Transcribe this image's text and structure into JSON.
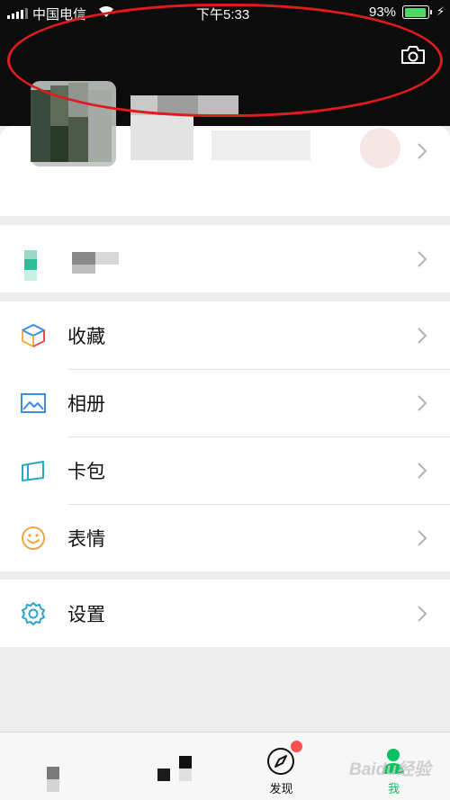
{
  "status_bar": {
    "carrier": "中国电信",
    "time": "下午5:33",
    "battery_percent": "93%",
    "battery_level": 0.93
  },
  "header": {
    "camera_icon": "camera-icon",
    "annotation_color": "#e01b1b"
  },
  "menu": {
    "services": {
      "icon": "service-icon"
    },
    "items": [
      {
        "label": "收藏",
        "icon": "favorites-cube-icon"
      },
      {
        "label": "相册",
        "icon": "album-picture-icon"
      },
      {
        "label": "卡包",
        "icon": "card-wallet-icon"
      },
      {
        "label": "表情",
        "icon": "smiley-face-icon"
      }
    ],
    "settings": {
      "label": "设置",
      "icon": "gear-icon"
    }
  },
  "tabbar": {
    "tabs": [
      {
        "label": "",
        "icon": "chats-icon"
      },
      {
        "label": "",
        "icon": "contacts-icon"
      },
      {
        "label": "发现",
        "icon": "compass-icon",
        "badge": true
      },
      {
        "label": "我",
        "icon": "me-person-icon",
        "active": true
      }
    ],
    "active_color": "#07c160",
    "badge_color": "#fa5151"
  },
  "watermark": "Baidu经验"
}
